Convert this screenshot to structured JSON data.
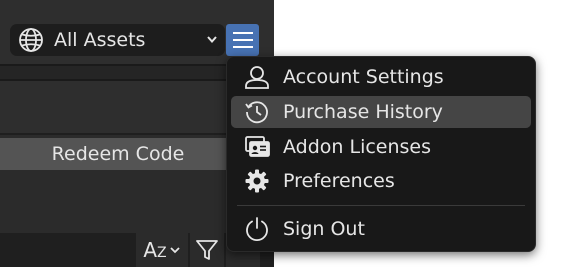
{
  "asset_selector": {
    "label": "All Assets",
    "icon": "globe-icon"
  },
  "menu_button": {
    "icon": "hamburger-menu-icon"
  },
  "redeem_button": {
    "label": "Redeem Code"
  },
  "toolbar": {
    "sort_label_a": "A",
    "sort_label_z": "Z",
    "filter_icon": "filter-icon"
  },
  "popup_menu": {
    "items": [
      {
        "label": "Account Settings",
        "icon": "user-icon",
        "mnemonic": "A"
      },
      {
        "label": "Purchase History",
        "icon": "history-icon",
        "mnemonic": "P",
        "active": true
      },
      {
        "label": "Addon Licenses",
        "icon": "license-card-icon",
        "mnemonic": "L"
      },
      {
        "label": "Preferences",
        "icon": "gear-icon",
        "mnemonic": "P"
      },
      {
        "label": "Sign Out",
        "icon": "power-icon",
        "mnemonic": "S"
      }
    ]
  },
  "colors": {
    "accent": "#4772b3",
    "panel_bg": "#2b2b2b",
    "popup_bg": "#181818",
    "active_item_bg": "#454545",
    "text": "#e6e6e6"
  }
}
